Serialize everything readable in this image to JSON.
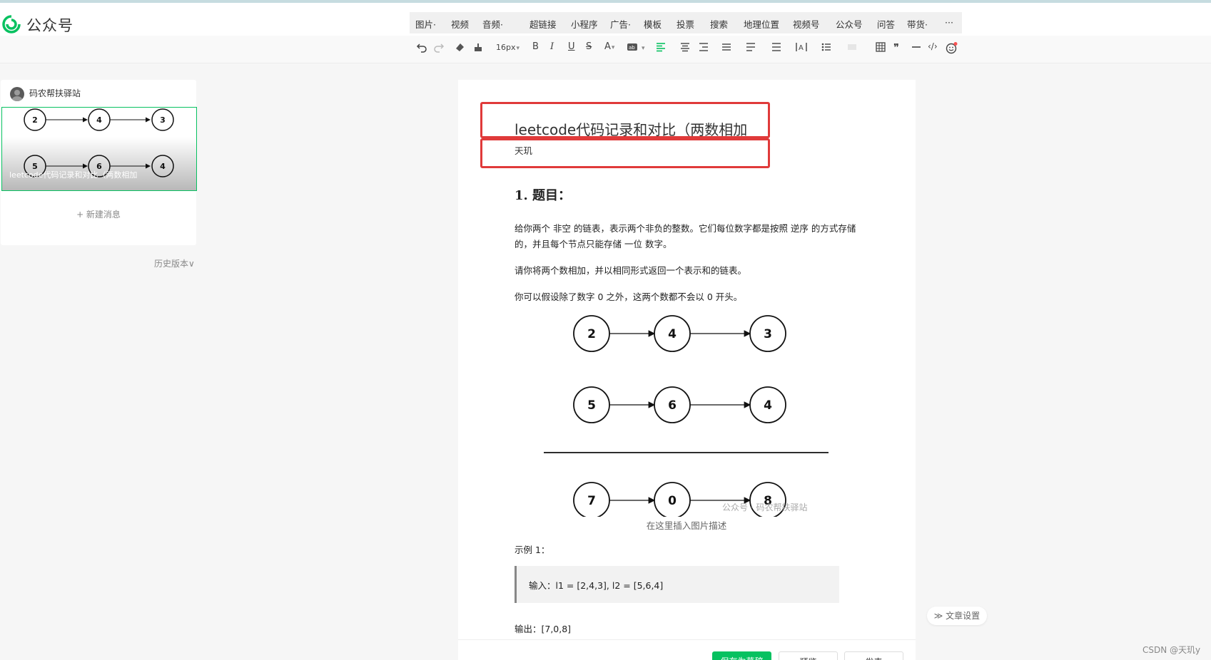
{
  "header": {
    "brand": "公众号"
  },
  "insert_menu": [
    {
      "label": "图片·",
      "icon": "image"
    },
    {
      "label": "视频",
      "icon": "video"
    },
    {
      "label": "音频·",
      "icon": "audio"
    },
    {
      "label": "超链接",
      "icon": "link"
    },
    {
      "label": "小程序",
      "icon": "mini-program"
    },
    {
      "label": "广告·",
      "icon": "ad"
    },
    {
      "label": "模板",
      "icon": "template"
    },
    {
      "label": "投票",
      "icon": "vote"
    },
    {
      "label": "搜索",
      "icon": "search"
    },
    {
      "label": "地理位置",
      "icon": "location"
    },
    {
      "label": "视频号",
      "icon": "channels"
    },
    {
      "label": "公众号",
      "icon": "official-account"
    },
    {
      "label": "问答",
      "icon": "qa"
    },
    {
      "label": "带货·",
      "icon": "shop"
    },
    {
      "label": "···",
      "icon": "more"
    }
  ],
  "format_toolbar": {
    "font_size": "16px",
    "bold": "B",
    "italic": "I",
    "underline": "U",
    "strikethrough": "S",
    "font_color": "A",
    "quote": "❞",
    "code": "‹/›"
  },
  "sidebar": {
    "account_name": "码农帮扶驿站",
    "article_thumb_title": "leetcode代码记录和对比（两数相加",
    "thumb_nodes": [
      "2",
      "4",
      "3",
      "5",
      "6",
      "4"
    ],
    "new_message": "+ 新建消息",
    "history_version": "历史版本∨"
  },
  "editor": {
    "title": "leetcode代码记录和对比（两数相加",
    "author": "天玑",
    "heading": "1. 题目：",
    "paragraphs": [
      "给你两个 非空 的链表，表示两个非负的整数。它们每位数字都是按照 逆序 的方式存储的，并且每个节点只能存储 一位 数字。",
      "请你将两个数相加，并以相同形式返回一个表示和的链表。",
      "你可以假设除了数字 0 之外，这两个数都不会以 0 开头。"
    ],
    "figure_rows": [
      [
        "2",
        "4",
        "3"
      ],
      [
        "5",
        "6",
        "4"
      ],
      [
        "7",
        "0",
        "8"
      ]
    ],
    "watermark": "公众号 · 码农帮扶驿站",
    "image_caption": "在这里插入图片描述",
    "example_label": "示例 1：",
    "code_input": "输入：l1 = [2,4,3], l2 = [5,6,4]",
    "output_line": "输出：[7,0,8]"
  },
  "bottom_bar": {
    "buttons": [
      "保存为草稿",
      "预览",
      "发表"
    ]
  },
  "article_settings": "≫ 文章设置",
  "csdn_watermark": "CSDN @天玑y",
  "colors": {
    "accent": "#07c160",
    "highlight": "#e03a3a"
  }
}
